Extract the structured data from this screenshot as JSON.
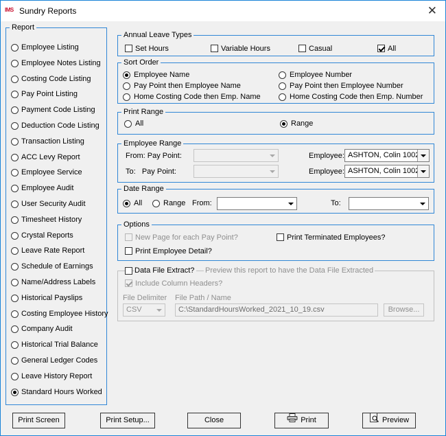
{
  "window": {
    "title": "Sundry Reports",
    "app_logo": "IMS",
    "close_glyph": "✕"
  },
  "report": {
    "title": "Report",
    "selected_index": 22,
    "items": [
      "Employee Listing",
      "Employee Notes Listing",
      "Costing Code Listing",
      "Pay Point Listing",
      "Payment Code Listing",
      "Deduction Code Listing",
      "Transaction Listing",
      "ACC Levy Report",
      "Employee Service",
      "Employee Audit",
      "User Security Audit",
      "Timesheet History",
      "Crystal Reports",
      "Leave Rate Report",
      "Schedule of Earnings",
      "Name/Address Labels",
      "Historical Payslips",
      "Costing Employee History",
      "Company Audit",
      "Historical Trial Balance",
      "General Ledger Codes",
      "Leave History Report",
      "Standard Hours Worked"
    ]
  },
  "annual_leave": {
    "title": "Annual Leave Types",
    "set_hours": "Set Hours",
    "variable_hours": "Variable Hours",
    "casual": "Casual",
    "all": "All"
  },
  "sort_order": {
    "title": "Sort Order",
    "employee_name": "Employee Name",
    "employee_number": "Employee Number",
    "pay_point_name": "Pay Point then Employee Name",
    "pay_point_number": "Pay Point then Employee Number",
    "home_costing_name": "Home Costing Code then Emp. Name",
    "home_costing_number": "Home Costing Code then Emp. Number"
  },
  "print_range": {
    "title": "Print Range",
    "all": "All",
    "range": "Range"
  },
  "employee_range": {
    "title": "Employee Range",
    "from_pay_point": "From: Pay Point:",
    "to_pay_point": "To:   Pay Point:",
    "employee_label": "Employee:",
    "from_employee": "ASHTON, Colin 1002",
    "to_employee": "ASHTON, Colin 1002"
  },
  "date_range": {
    "title": "Date Range",
    "all": "All",
    "range": "Range",
    "from": "From:",
    "to": "To:"
  },
  "options": {
    "title": "Options",
    "new_page": "New Page for each Pay Point?",
    "print_terminated": "Print Terminated Employees?",
    "print_detail": "Print Employee Detail?"
  },
  "data_file": {
    "extract_label": "Data File Extract?",
    "hint": "Preview this report to have the Data File Extracted",
    "include_headers": "Include Column Headers?",
    "delimiter_label": "File Delimiter",
    "delimiter_value": "CSV",
    "path_label": "File Path / Name",
    "path_value": "C:\\StandardHoursWorked_2021_10_19.csv",
    "browse": "Browse..."
  },
  "buttons": {
    "print_screen": "Print Screen",
    "print_setup": "Print Setup...",
    "close": "Close",
    "print": "Print",
    "preview": "Preview"
  }
}
